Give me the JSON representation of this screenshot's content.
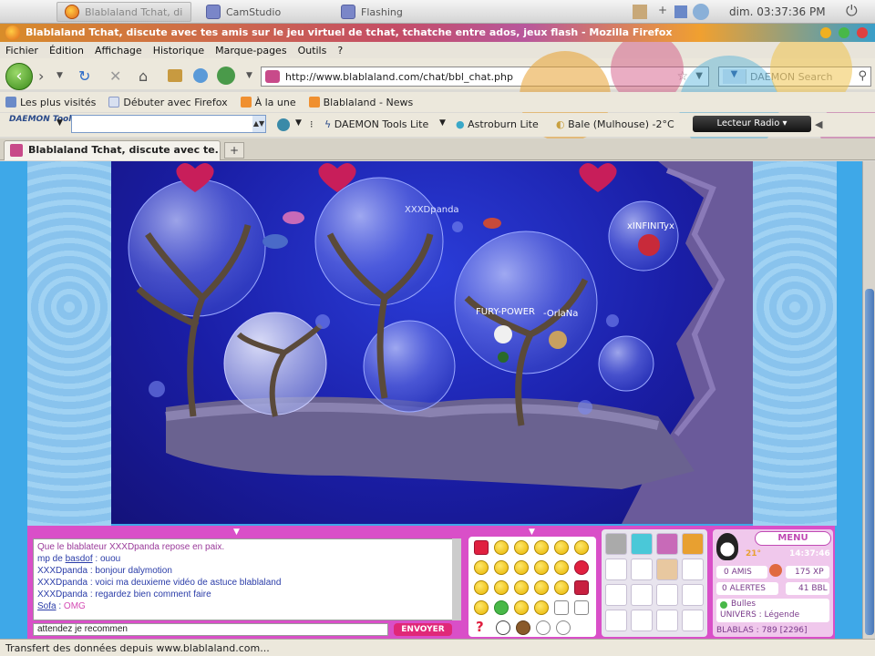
{
  "taskbar": {
    "tasks": [
      {
        "label": "Blablaland Tchat, di"
      },
      {
        "label": "CamStudio"
      },
      {
        "label": "Flashing"
      }
    ],
    "clock": "dim. 03:37:36 PM"
  },
  "window": {
    "title": "Blablaland Tchat, discute avec tes amis sur le jeu virtuel de tchat, tchatche entre ados, jeux flash - Mozilla Firefox"
  },
  "menu": {
    "items": [
      "Fichier",
      "Édition",
      "Affichage",
      "Historique",
      "Marque-pages",
      "Outils",
      "?"
    ]
  },
  "navigation": {
    "url": "http://www.blablaland.com/chat/bbl_chat.php",
    "search_placeholder": "DAEMON Search"
  },
  "bookmarks": {
    "items": [
      "Les plus visités",
      "Débuter avec Firefox",
      "À la une",
      "Blablaland - News"
    ]
  },
  "daemon_toolbar": {
    "logo": "DAEMON Tools",
    "items": [
      "DAEMON Tools Lite",
      "Astroburn Lite",
      "Bale (Mulhouse) -2°C"
    ],
    "radio_label": "Lecteur Radio"
  },
  "tabs": [
    {
      "label": "Blablaland Tchat, discute avec te..."
    }
  ],
  "game": {
    "player_labels": [
      "XXXDpanda",
      "FURY-POWER",
      "-OrlaNa",
      "xINFINITyx"
    ],
    "chat_log": [
      {
        "type": "sys",
        "text": "Que le blablateur XXXDpanda repose en paix."
      },
      {
        "type": "mp",
        "prefix": "mp de",
        "who": "basdof",
        "text": "ouou"
      },
      {
        "type": "msg",
        "who": "XXXDpanda",
        "text": "bonjour dalymotion"
      },
      {
        "type": "msg",
        "who": "XXXDpanda",
        "text": "voici ma deuxieme vidéo de astuce blablaland"
      },
      {
        "type": "msg",
        "who": "XXXDpanda",
        "text": "regardez bien comment faire"
      },
      {
        "type": "omg",
        "who": "Sofa",
        "text": "OMG"
      }
    ],
    "chat_input_value": "attendez je recommen",
    "send_label": "ENVOYER",
    "profile": {
      "menu_label": "MENU",
      "temperature": "21°",
      "time": "14:37:46",
      "friends": "0 AMIS",
      "xp": "175 XP",
      "alerts": "0 ALERTES",
      "bbl": "41 BBL",
      "username": "Bulles",
      "univers": "UNIVERS : Légende",
      "blablas": "BLABLAS : 789 [2296]"
    }
  },
  "status": {
    "text": "Transfert des données depuis www.blablaland.com..."
  },
  "colors": {
    "chat_pink": "#d94fc8",
    "scene_blue": "#1a1ea6",
    "send_button": "#e02878",
    "back_button": "#3a8a1a"
  }
}
